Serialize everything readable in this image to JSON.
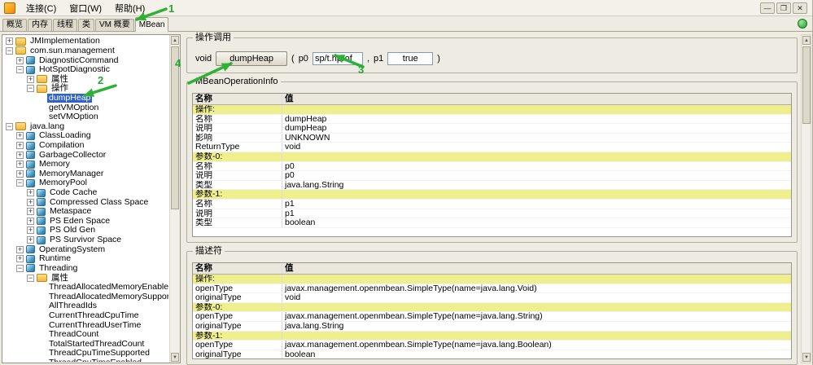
{
  "menubar": {
    "items": [
      "连接(C)",
      "窗口(W)",
      "帮助(H)"
    ]
  },
  "icons": {
    "minimize": "—",
    "restore": "❐",
    "close": "✕",
    "scroll_up": "▲",
    "scroll_down": "▼"
  },
  "tabs": {
    "items": [
      "概览",
      "内存",
      "线程",
      "类",
      "VM 概要",
      "MBean"
    ],
    "selected": "MBean"
  },
  "tree": {
    "items": [
      {
        "label": "JMImplementation",
        "depth": 0,
        "handle": "plus",
        "icon": "folder"
      },
      {
        "label": "com.sun.management",
        "depth": 0,
        "handle": "minus",
        "icon": "folder"
      },
      {
        "label": "DiagnosticCommand",
        "depth": 1,
        "handle": "plus",
        "icon": "bean"
      },
      {
        "label": "HotSpotDiagnostic",
        "depth": 1,
        "handle": "minus",
        "icon": "bean"
      },
      {
        "label": "属性",
        "depth": 2,
        "handle": "plus",
        "icon": "folder"
      },
      {
        "label": "操作",
        "depth": 2,
        "handle": "minus",
        "icon": "folder"
      },
      {
        "label": "dumpHeap",
        "depth": 3,
        "selected": true
      },
      {
        "label": "getVMOption",
        "depth": 3
      },
      {
        "label": "setVMOption",
        "depth": 3
      },
      {
        "label": "java.lang",
        "depth": 0,
        "handle": "minus",
        "icon": "folder"
      },
      {
        "label": "ClassLoading",
        "depth": 1,
        "handle": "plus",
        "icon": "bean"
      },
      {
        "label": "Compilation",
        "depth": 1,
        "handle": "plus",
        "icon": "bean"
      },
      {
        "label": "GarbageCollector",
        "depth": 1,
        "handle": "plus",
        "icon": "bean"
      },
      {
        "label": "Memory",
        "depth": 1,
        "handle": "plus",
        "icon": "bean"
      },
      {
        "label": "MemoryManager",
        "depth": 1,
        "handle": "plus",
        "icon": "bean"
      },
      {
        "label": "MemoryPool",
        "depth": 1,
        "handle": "minus",
        "icon": "bean"
      },
      {
        "label": "Code Cache",
        "depth": 2,
        "handle": "plus",
        "icon": "bean"
      },
      {
        "label": "Compressed Class Space",
        "depth": 2,
        "handle": "plus",
        "icon": "bean"
      },
      {
        "label": "Metaspace",
        "depth": 2,
        "handle": "plus",
        "icon": "bean"
      },
      {
        "label": "PS Eden Space",
        "depth": 2,
        "handle": "plus",
        "icon": "bean"
      },
      {
        "label": "PS Old Gen",
        "depth": 2,
        "handle": "plus",
        "icon": "bean"
      },
      {
        "label": "PS Survivor Space",
        "depth": 2,
        "handle": "plus",
        "icon": "bean"
      },
      {
        "label": "OperatingSystem",
        "depth": 1,
        "handle": "plus",
        "icon": "bean"
      },
      {
        "label": "Runtime",
        "depth": 1,
        "handle": "plus",
        "icon": "bean"
      },
      {
        "label": "Threading",
        "depth": 1,
        "handle": "minus",
        "icon": "bean"
      },
      {
        "label": "属性",
        "depth": 2,
        "handle": "minus",
        "icon": "folder"
      },
      {
        "label": "ThreadAllocatedMemoryEnabled",
        "depth": 3
      },
      {
        "label": "ThreadAllocatedMemorySupported",
        "depth": 3
      },
      {
        "label": "AllThreadIds",
        "depth": 3
      },
      {
        "label": "CurrentThreadCpuTime",
        "depth": 3
      },
      {
        "label": "CurrentThreadUserTime",
        "depth": 3
      },
      {
        "label": "ThreadCount",
        "depth": 3
      },
      {
        "label": "TotalStartedThreadCount",
        "depth": 3
      },
      {
        "label": "ThreadCpuTimeSupported",
        "depth": 3
      },
      {
        "label": "ThreadCpuTimeEnabled",
        "depth": 3
      }
    ]
  },
  "operation": {
    "group_title": "操作调用",
    "return_type": "void",
    "button_label": "dumpHeap",
    "paren_open": "(",
    "p0_label": "p0",
    "p0_value": "sp/t.hprof",
    "comma": ",",
    "p1_label": "p1",
    "p1_value": "true",
    "paren_close": ")"
  },
  "operation_info": {
    "group_title": "MBeanOperationInfo",
    "columns": [
      "名称",
      "值"
    ],
    "rows": [
      {
        "name": "操作:",
        "value": "",
        "section": true
      },
      {
        "name": "名称",
        "value": "dumpHeap"
      },
      {
        "name": "说明",
        "value": "dumpHeap"
      },
      {
        "name": "影响",
        "value": "UNKNOWN"
      },
      {
        "name": "ReturnType",
        "value": "void"
      },
      {
        "name": "参数-0:",
        "value": "",
        "section": true
      },
      {
        "name": "名称",
        "value": "p0"
      },
      {
        "name": "说明",
        "value": "p0"
      },
      {
        "name": "类型",
        "value": "java.lang.String"
      },
      {
        "name": "参数-1:",
        "value": "",
        "section": true
      },
      {
        "name": "名称",
        "value": "p1"
      },
      {
        "name": "说明",
        "value": "p1"
      },
      {
        "name": "类型",
        "value": "boolean"
      }
    ]
  },
  "descriptor": {
    "group_title": "描述符",
    "columns": [
      "名称",
      "值"
    ],
    "rows": [
      {
        "name": "操作:",
        "value": "",
        "section": true
      },
      {
        "name": "openType",
        "value": "javax.management.openmbean.SimpleType(name=java.lang.Void)"
      },
      {
        "name": "originalType",
        "value": "void"
      },
      {
        "name": "参数-0:",
        "value": "",
        "section": true
      },
      {
        "name": "openType",
        "value": "javax.management.openmbean.SimpleType(name=java.lang.String)"
      },
      {
        "name": "originalType",
        "value": "java.lang.String"
      },
      {
        "name": "参数-1:",
        "value": "",
        "section": true
      },
      {
        "name": "openType",
        "value": "javax.management.openmbean.SimpleType(name=java.lang.Boolean)"
      },
      {
        "name": "originalType",
        "value": "boolean"
      }
    ]
  },
  "annotations": {
    "numbers": [
      "1",
      "2",
      "3",
      "4"
    ],
    "arrow_color": "#2eb135"
  }
}
